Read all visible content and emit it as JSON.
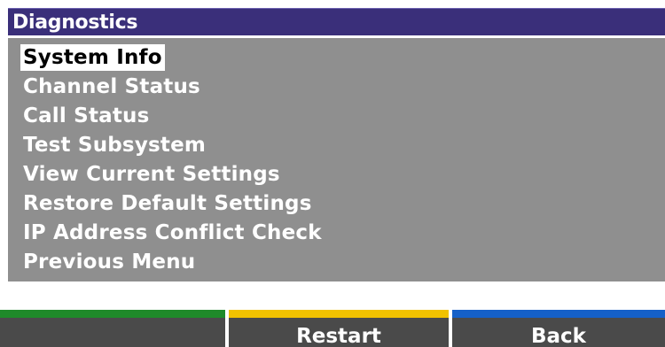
{
  "header": {
    "title": "Diagnostics"
  },
  "menu": {
    "items": [
      {
        "label": "System Info",
        "selected": true
      },
      {
        "label": "Channel Status",
        "selected": false
      },
      {
        "label": "Call Status",
        "selected": false
      },
      {
        "label": "Test Subsystem",
        "selected": false
      },
      {
        "label": "View Current Settings",
        "selected": false
      },
      {
        "label": "Restore Default Settings",
        "selected": false
      },
      {
        "label": "IP Address Conflict Check",
        "selected": false
      },
      {
        "label": "Previous Menu",
        "selected": false
      }
    ]
  },
  "softkeys": [
    {
      "label": "",
      "color": "#1f8a2a"
    },
    {
      "label": "Restart",
      "color": "#f2c200"
    },
    {
      "label": "Back",
      "color": "#1560c8"
    }
  ],
  "colors": {
    "title_bar": "#3a2f7a",
    "menu_background": "#8f8f8f",
    "softkey_background": "#4a4a4a"
  }
}
